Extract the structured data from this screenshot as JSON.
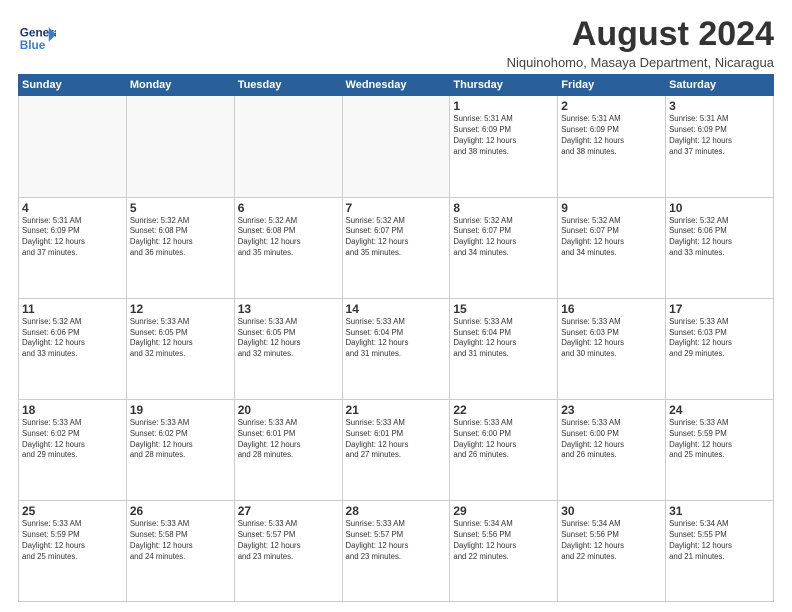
{
  "logo": {
    "line1": "General",
    "line2": "Blue"
  },
  "title": "August 2024",
  "location": "Niquinohomo, Masaya Department, Nicaragua",
  "days_header": [
    "Sunday",
    "Monday",
    "Tuesday",
    "Wednesday",
    "Thursday",
    "Friday",
    "Saturday"
  ],
  "weeks": [
    [
      {
        "day": "",
        "info": ""
      },
      {
        "day": "",
        "info": ""
      },
      {
        "day": "",
        "info": ""
      },
      {
        "day": "",
        "info": ""
      },
      {
        "day": "1",
        "info": "Sunrise: 5:31 AM\nSunset: 6:09 PM\nDaylight: 12 hours\nand 38 minutes."
      },
      {
        "day": "2",
        "info": "Sunrise: 5:31 AM\nSunset: 6:09 PM\nDaylight: 12 hours\nand 38 minutes."
      },
      {
        "day": "3",
        "info": "Sunrise: 5:31 AM\nSunset: 6:09 PM\nDaylight: 12 hours\nand 37 minutes."
      }
    ],
    [
      {
        "day": "4",
        "info": "Sunrise: 5:31 AM\nSunset: 6:09 PM\nDaylight: 12 hours\nand 37 minutes."
      },
      {
        "day": "5",
        "info": "Sunrise: 5:32 AM\nSunset: 6:08 PM\nDaylight: 12 hours\nand 36 minutes."
      },
      {
        "day": "6",
        "info": "Sunrise: 5:32 AM\nSunset: 6:08 PM\nDaylight: 12 hours\nand 35 minutes."
      },
      {
        "day": "7",
        "info": "Sunrise: 5:32 AM\nSunset: 6:07 PM\nDaylight: 12 hours\nand 35 minutes."
      },
      {
        "day": "8",
        "info": "Sunrise: 5:32 AM\nSunset: 6:07 PM\nDaylight: 12 hours\nand 34 minutes."
      },
      {
        "day": "9",
        "info": "Sunrise: 5:32 AM\nSunset: 6:07 PM\nDaylight: 12 hours\nand 34 minutes."
      },
      {
        "day": "10",
        "info": "Sunrise: 5:32 AM\nSunset: 6:06 PM\nDaylight: 12 hours\nand 33 minutes."
      }
    ],
    [
      {
        "day": "11",
        "info": "Sunrise: 5:32 AM\nSunset: 6:06 PM\nDaylight: 12 hours\nand 33 minutes."
      },
      {
        "day": "12",
        "info": "Sunrise: 5:33 AM\nSunset: 6:05 PM\nDaylight: 12 hours\nand 32 minutes."
      },
      {
        "day": "13",
        "info": "Sunrise: 5:33 AM\nSunset: 6:05 PM\nDaylight: 12 hours\nand 32 minutes."
      },
      {
        "day": "14",
        "info": "Sunrise: 5:33 AM\nSunset: 6:04 PM\nDaylight: 12 hours\nand 31 minutes."
      },
      {
        "day": "15",
        "info": "Sunrise: 5:33 AM\nSunset: 6:04 PM\nDaylight: 12 hours\nand 31 minutes."
      },
      {
        "day": "16",
        "info": "Sunrise: 5:33 AM\nSunset: 6:03 PM\nDaylight: 12 hours\nand 30 minutes."
      },
      {
        "day": "17",
        "info": "Sunrise: 5:33 AM\nSunset: 6:03 PM\nDaylight: 12 hours\nand 29 minutes."
      }
    ],
    [
      {
        "day": "18",
        "info": "Sunrise: 5:33 AM\nSunset: 6:02 PM\nDaylight: 12 hours\nand 29 minutes."
      },
      {
        "day": "19",
        "info": "Sunrise: 5:33 AM\nSunset: 6:02 PM\nDaylight: 12 hours\nand 28 minutes."
      },
      {
        "day": "20",
        "info": "Sunrise: 5:33 AM\nSunset: 6:01 PM\nDaylight: 12 hours\nand 28 minutes."
      },
      {
        "day": "21",
        "info": "Sunrise: 5:33 AM\nSunset: 6:01 PM\nDaylight: 12 hours\nand 27 minutes."
      },
      {
        "day": "22",
        "info": "Sunrise: 5:33 AM\nSunset: 6:00 PM\nDaylight: 12 hours\nand 26 minutes."
      },
      {
        "day": "23",
        "info": "Sunrise: 5:33 AM\nSunset: 6:00 PM\nDaylight: 12 hours\nand 26 minutes."
      },
      {
        "day": "24",
        "info": "Sunrise: 5:33 AM\nSunset: 5:59 PM\nDaylight: 12 hours\nand 25 minutes."
      }
    ],
    [
      {
        "day": "25",
        "info": "Sunrise: 5:33 AM\nSunset: 5:59 PM\nDaylight: 12 hours\nand 25 minutes."
      },
      {
        "day": "26",
        "info": "Sunrise: 5:33 AM\nSunset: 5:58 PM\nDaylight: 12 hours\nand 24 minutes."
      },
      {
        "day": "27",
        "info": "Sunrise: 5:33 AM\nSunset: 5:57 PM\nDaylight: 12 hours\nand 23 minutes."
      },
      {
        "day": "28",
        "info": "Sunrise: 5:33 AM\nSunset: 5:57 PM\nDaylight: 12 hours\nand 23 minutes."
      },
      {
        "day": "29",
        "info": "Sunrise: 5:34 AM\nSunset: 5:56 PM\nDaylight: 12 hours\nand 22 minutes."
      },
      {
        "day": "30",
        "info": "Sunrise: 5:34 AM\nSunset: 5:56 PM\nDaylight: 12 hours\nand 22 minutes."
      },
      {
        "day": "31",
        "info": "Sunrise: 5:34 AM\nSunset: 5:55 PM\nDaylight: 12 hours\nand 21 minutes."
      }
    ]
  ]
}
